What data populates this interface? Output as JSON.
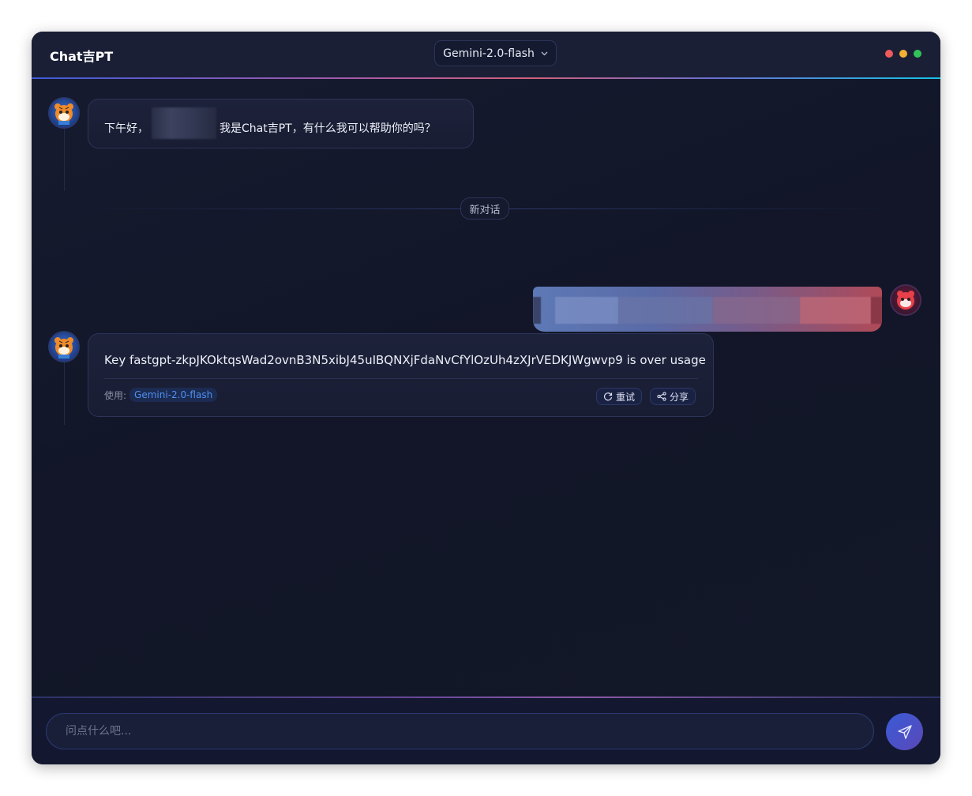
{
  "app": {
    "brand": "Chat吉PT",
    "model": "Gemini-2.0-flash",
    "window_controls": [
      "close",
      "minimize",
      "maximize"
    ]
  },
  "colors": {
    "light_red": "#ef5b5b",
    "light_yellow": "#f2b134",
    "light_green": "#32c25a"
  },
  "messages": {
    "greeting": {
      "prefix": "下午好，",
      "suffix": "我是Chat吉PT，有什么我可以帮助你的吗？"
    },
    "divider_label": "新对话",
    "reply": {
      "text": "Key fastgpt-zkpJKOktqsWad2ovnB3N5xibJ45uIBQNXjFdaNvCfYlOzUh4zXJrVEDKJWgwvp9 is over usage",
      "used_label": "使用:",
      "model_tag": "Gemini-2.0-flash",
      "retry_label": "重试",
      "share_label": "分享"
    }
  },
  "input": {
    "placeholder": "问点什么吧..."
  }
}
